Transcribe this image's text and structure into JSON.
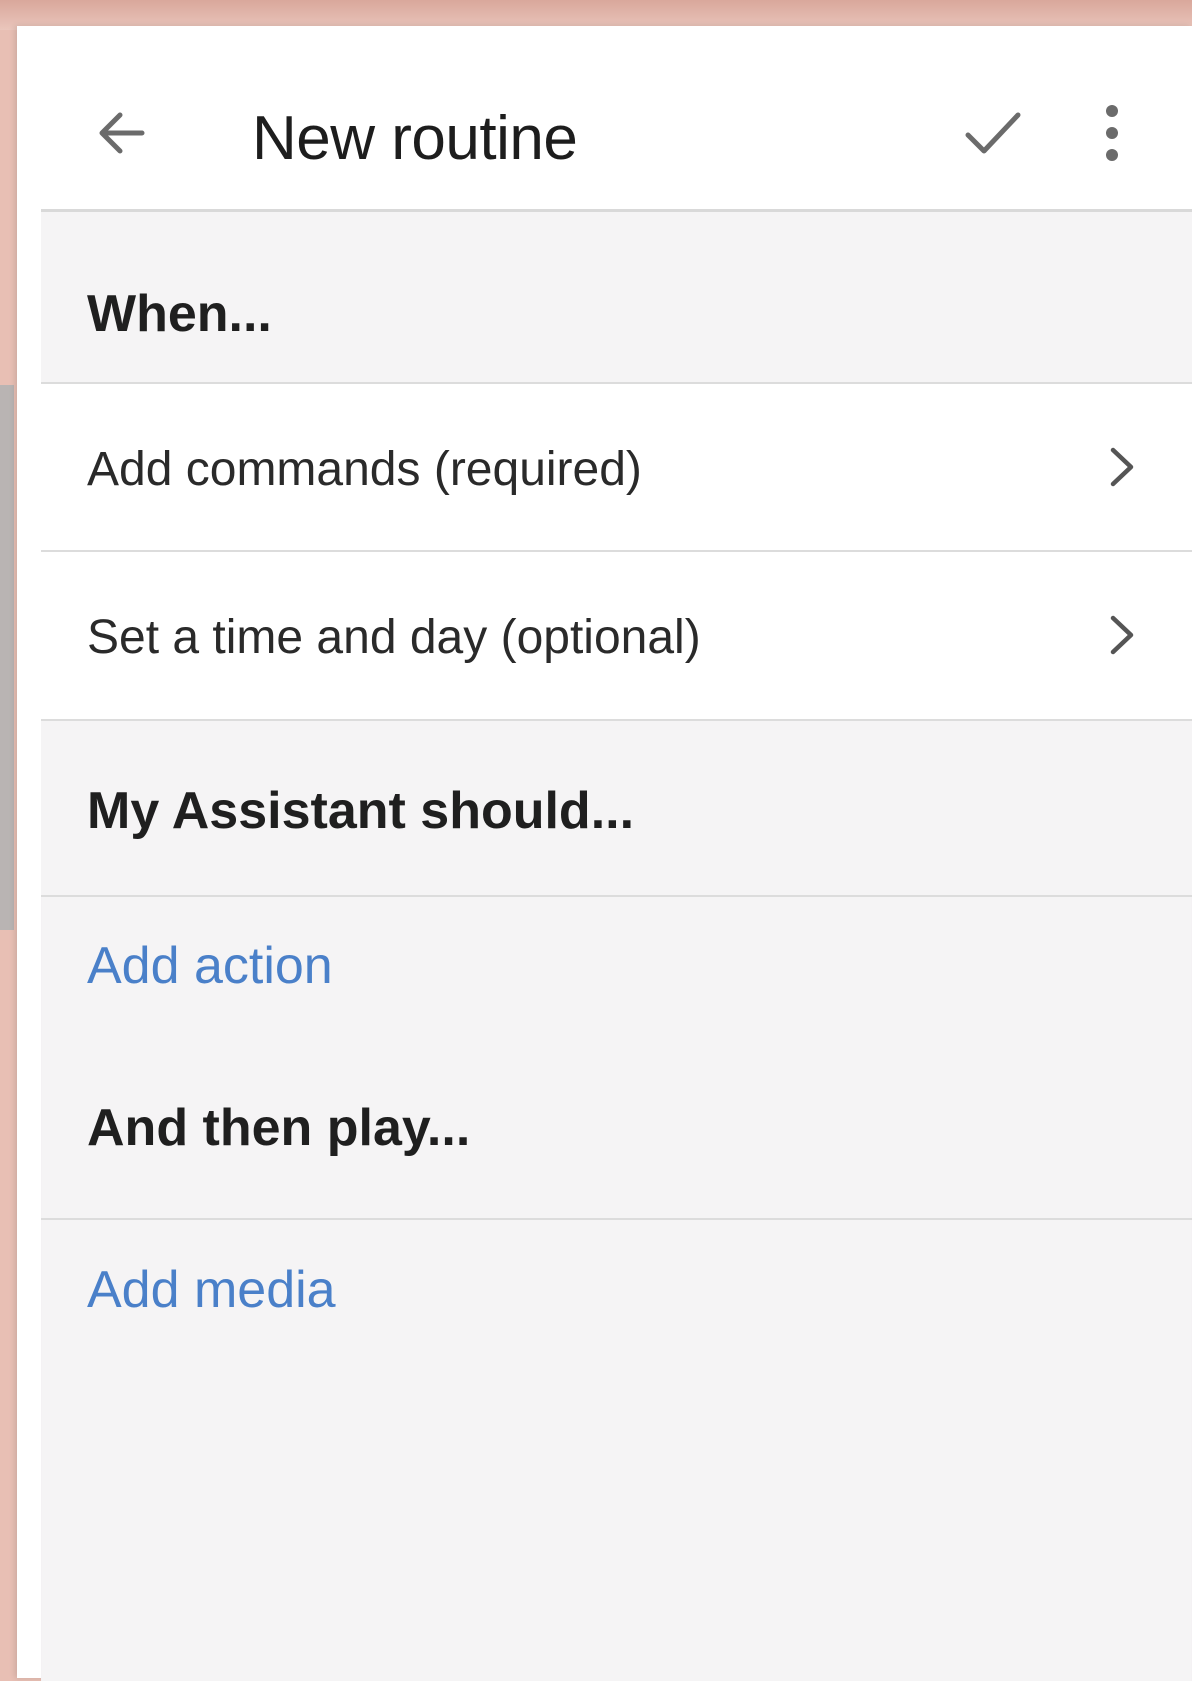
{
  "app_bar": {
    "title": "New routine",
    "back_icon": "arrow-back-icon",
    "save_icon": "check-icon",
    "more_icon": "more-vert-icon"
  },
  "when_section": {
    "header": "When...",
    "rows": [
      {
        "label": "Add commands (required)",
        "icon": "chevron-right-icon"
      },
      {
        "label": "Set a time and day (optional)",
        "icon": "chevron-right-icon"
      }
    ]
  },
  "assistant_section": {
    "header": "My Assistant should...",
    "add_action_label": "Add action"
  },
  "media_section": {
    "header": "And then play...",
    "add_media_label": "Add media"
  },
  "colors": {
    "link": "#4a80c9",
    "section_background": "#f5f4f5",
    "row_background": "#ffffff"
  }
}
